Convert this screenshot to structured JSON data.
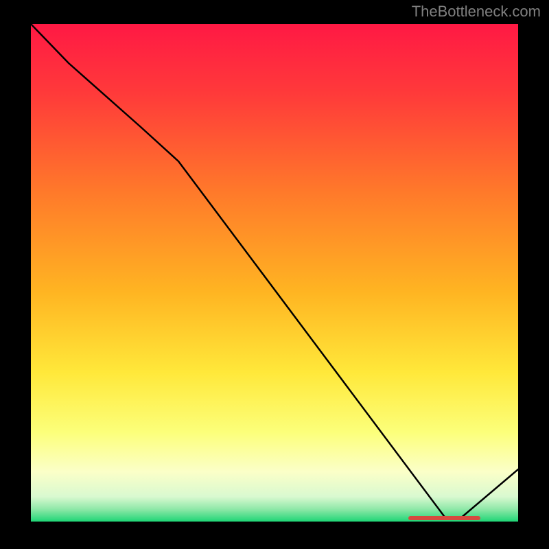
{
  "watermark": "TheBottleneck.com",
  "chart_data": {
    "type": "line",
    "title": "",
    "xlabel": "",
    "ylabel": "",
    "x": [
      0,
      0.08,
      0.22,
      0.3,
      0.85,
      0.88,
      1.0
    ],
    "values": [
      1.0,
      0.92,
      0.79,
      0.73,
      0.0,
      0.0,
      0.1
    ],
    "xlim": [
      0,
      1
    ],
    "ylim": [
      0,
      1
    ],
    "highlight_band": {
      "y0": 0.0,
      "y1": 0.025
    },
    "baseline_marker": {
      "x0": 0.78,
      "x1": 0.92,
      "y": 0.003,
      "label": ""
    },
    "gradient_stops": [
      {
        "offset": 0.0,
        "color": "#ff1944"
      },
      {
        "offset": 0.15,
        "color": "#ff3a3a"
      },
      {
        "offset": 0.35,
        "color": "#ff7a2a"
      },
      {
        "offset": 0.55,
        "color": "#ffb522"
      },
      {
        "offset": 0.7,
        "color": "#ffe83a"
      },
      {
        "offset": 0.85,
        "color": "#fcff7a"
      },
      {
        "offset": 0.93,
        "color": "#f8ffd8"
      },
      {
        "offset": 0.965,
        "color": "#b8f5c0"
      },
      {
        "offset": 1.0,
        "color": "#1fd676"
      }
    ]
  }
}
